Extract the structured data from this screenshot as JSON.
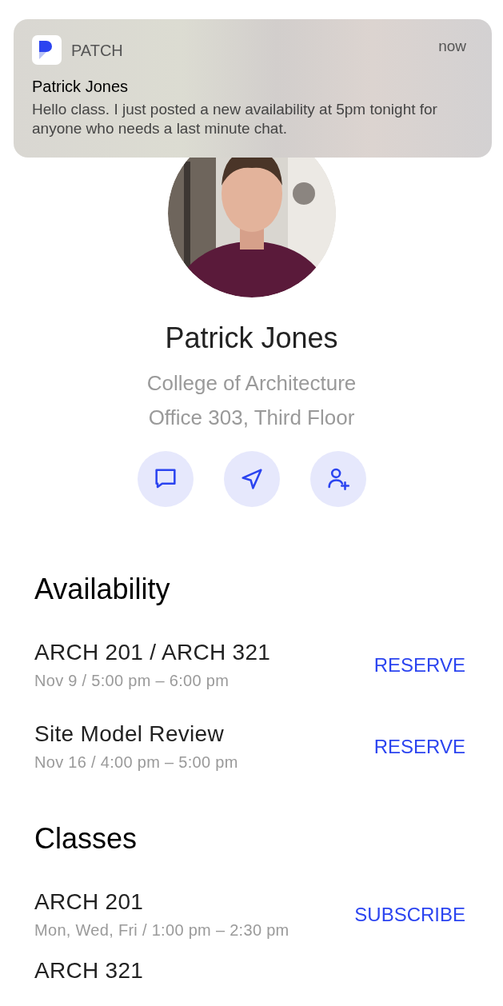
{
  "notification": {
    "app": "PATCH",
    "time": "now",
    "sender": "Patrick Jones",
    "message": "Hello class. I just posted a new availability at 5pm tonight for anyone who needs a last minute chat."
  },
  "profile": {
    "photo": {
      "kind": "picture"
    },
    "name": "Patrick Jones",
    "lines": [
      "College of Architecture",
      "Office 303, Third Floor"
    ],
    "actions": [
      {
        "kind": "message"
      },
      {
        "kind": "navigate"
      },
      {
        "kind": "add-contact"
      }
    ]
  },
  "sections": [
    {
      "title": "Availability",
      "items": [
        {
          "title": "ARCH 201 / ARCH 321",
          "subtitle": "Nov 9 / 5:00 pm – 6:00 pm",
          "action": "RESERVE"
        },
        {
          "title": "Site Model Review",
          "subtitle": "Nov 16 / 4:00 pm – 5:00 pm",
          "action": "RESERVE"
        }
      ]
    },
    {
      "title": "Classes",
      "items": [
        {
          "title": "ARCH 201",
          "subtitle": "Mon, Wed, Fri / 1:00 pm – 2:30 pm",
          "action": "SUBSCRIBE"
        },
        {
          "title": "ARCH 321"
        }
      ]
    }
  ]
}
